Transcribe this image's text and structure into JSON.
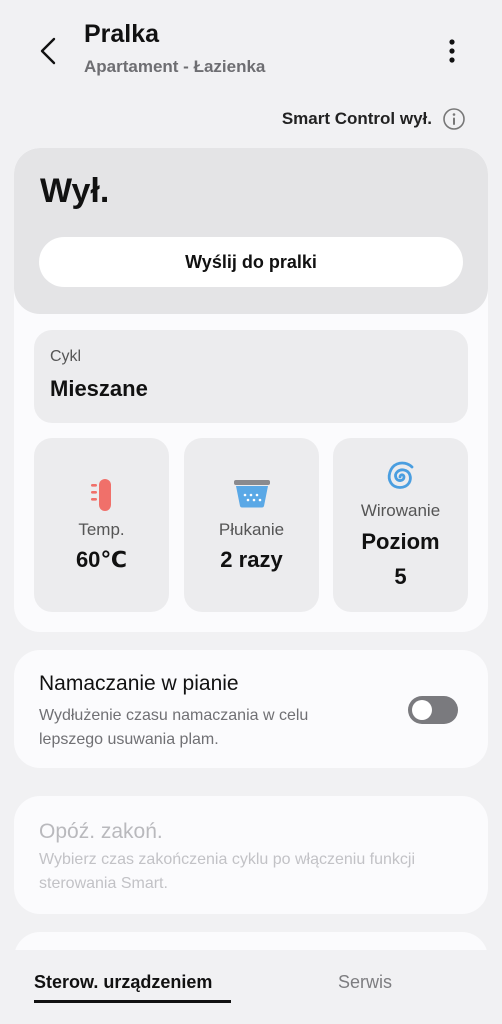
{
  "header": {
    "title": "Pralka",
    "subtitle": "Apartament - Łazienka"
  },
  "smart_control": {
    "label": "Smart Control wył."
  },
  "status": {
    "text": "Wył.",
    "send_button": "Wyślij do pralki"
  },
  "cycle": {
    "label": "Cykl",
    "value": "Mieszane"
  },
  "options": {
    "temp": {
      "label": "Temp.",
      "value": "60℃",
      "icon": "thermometer-icon"
    },
    "rinse": {
      "label": "Płukanie",
      "value": "2 razy",
      "icon": "rinse-basin-icon"
    },
    "spin": {
      "label": "Wirowanie",
      "value_line1": "Poziom",
      "value_line2": "5",
      "icon": "spin-spiral-icon"
    }
  },
  "soak": {
    "title": "Namaczanie w pianie",
    "description": "Wydłużenie czasu namaczania w celu lepszego usuwania plam.",
    "toggle_on": false
  },
  "delay_end": {
    "title": "Opóź. zakoń.",
    "description": "Wybierz czas zakończenia cyklu po włączeniu funkcji sterowania Smart."
  },
  "bottom_nav": {
    "tabs": [
      {
        "label": "Sterow. urządzeniem",
        "active": true
      },
      {
        "label": "Serwis",
        "active": false
      }
    ]
  },
  "colors": {
    "thermometer": "#f0706a",
    "rinse": "#5aa8e6",
    "spin": "#4a9ee0",
    "toggle_off": "#7a7a7e"
  }
}
